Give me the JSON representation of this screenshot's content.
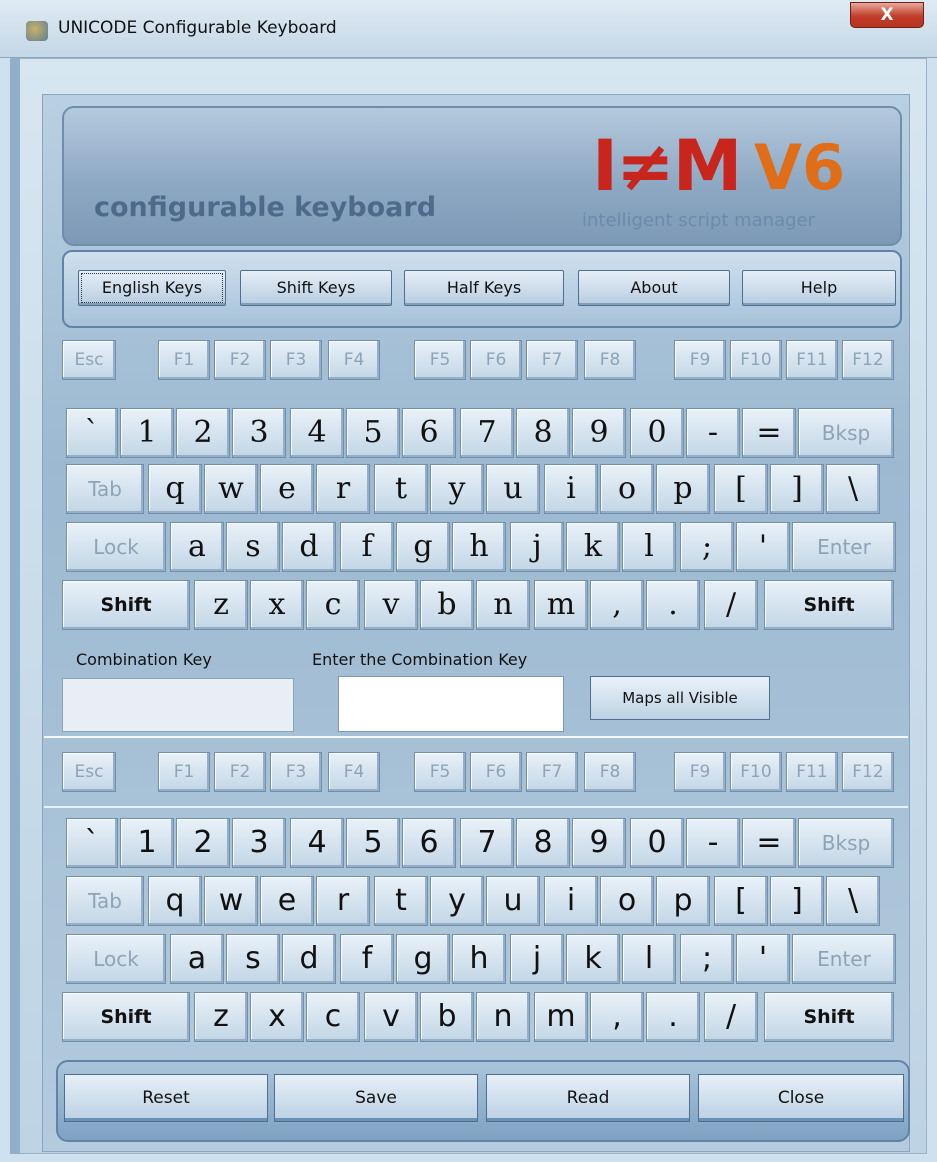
{
  "window": {
    "title": "UNICODE Configurable Keyboard",
    "close_label": "X"
  },
  "banner": {
    "caption": "configurable keyboard",
    "logo_main": "I≠M",
    "logo_version": "V6",
    "tagline": "intelligent script manager"
  },
  "menu": [
    "English Keys",
    "Shift Keys",
    "Half Keys",
    "About",
    "Help"
  ],
  "function_row": [
    "Esc",
    "F1",
    "F2",
    "F3",
    "F4",
    "F5",
    "F6",
    "F7",
    "F8",
    "F9",
    "F10",
    "F11",
    "F12"
  ],
  "keyboard_top": {
    "number_row": [
      "`",
      "1",
      "2",
      "3",
      "4",
      "5",
      "6",
      "7",
      "8",
      "9",
      "0",
      "-",
      "=",
      "Bksp"
    ],
    "qwerty_row": [
      "Tab",
      "q",
      "w",
      "e",
      "r",
      "t",
      "y",
      "u",
      "i",
      "o",
      "p",
      "[",
      "]",
      "\\"
    ],
    "home_row": [
      "Lock",
      "a",
      "s",
      "d",
      "f",
      "g",
      "h",
      "j",
      "k",
      "l",
      ";",
      "'",
      "Enter"
    ],
    "shift_row": [
      "Shift",
      "z",
      "x",
      "c",
      "v",
      "b",
      "n",
      "m",
      ",",
      ".",
      "/",
      "Shift"
    ]
  },
  "combination": {
    "combo_label": "Combination Key",
    "enter_label": "Enter the Combination Key",
    "combo_value": "",
    "enter_value": "",
    "maps_button": "Maps all Visible"
  },
  "keyboard_bottom": {
    "number_row": [
      "`",
      "1",
      "2",
      "3",
      "4",
      "5",
      "6",
      "7",
      "8",
      "9",
      "0",
      "-",
      "=",
      "Bksp"
    ],
    "qwerty_row": [
      "Tab",
      "q",
      "w",
      "e",
      "r",
      "t",
      "y",
      "u",
      "i",
      "o",
      "p",
      "[",
      "]",
      "\\"
    ],
    "home_row": [
      "Lock",
      "a",
      "s",
      "d",
      "f",
      "g",
      "h",
      "j",
      "k",
      "l",
      ";",
      "'",
      "Enter"
    ],
    "shift_row": [
      "Shift",
      "z",
      "x",
      "c",
      "v",
      "b",
      "n",
      "m",
      ",",
      ".",
      "/",
      "Shift"
    ]
  },
  "actions": [
    "Reset",
    "Save",
    "Read",
    "Close"
  ]
}
